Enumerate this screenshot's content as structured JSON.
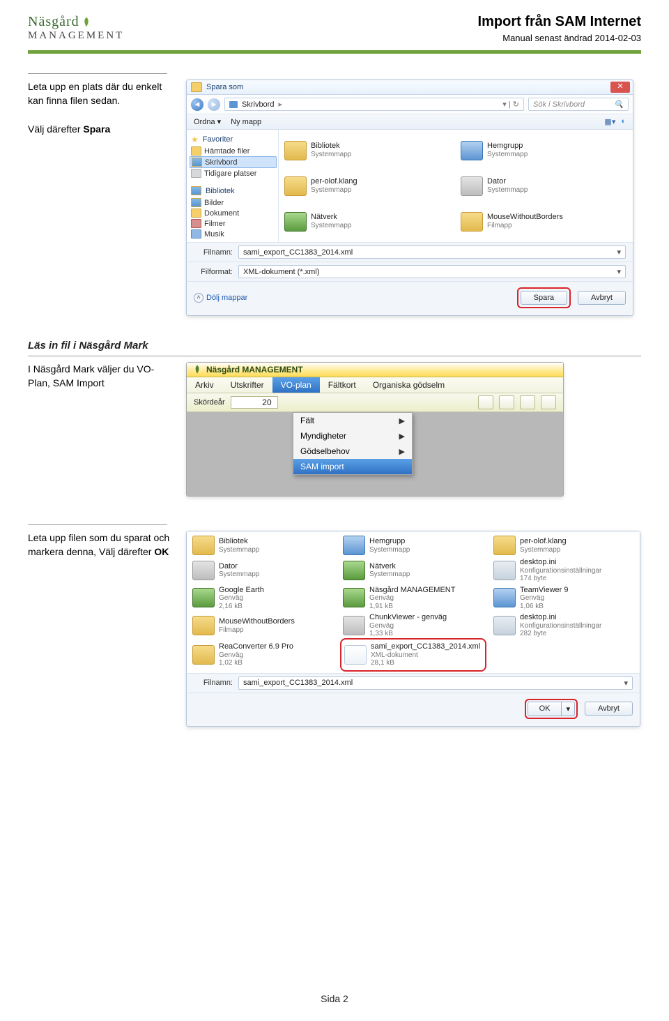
{
  "header": {
    "logo_top": "Näsgård",
    "logo_bottom": "MANAGEMENT",
    "title": "Import från SAM Internet",
    "subtitle": "Manual senast ändrad 2014-02-03"
  },
  "section1": {
    "instr_line1": "Leta upp en plats där du enkelt kan finna filen sedan.",
    "instr_line2a": "Välj därefter ",
    "instr_line2b": "Spara",
    "dlg": {
      "title": "Spara som",
      "crumb_loc": "Skrivbord",
      "search_ph": "Sök i Skrivbord",
      "tb_ordna": "Ordna ▾",
      "tb_ny": "Ny mapp",
      "tree_fav": "Favoriter",
      "tree_fav_items": [
        "Hämtade filer",
        "Skrivbord",
        "Tidigare platser"
      ],
      "tree_bib": "Bibliotek",
      "tree_bib_items": [
        "Bilder",
        "Dokument",
        "Filmer",
        "Musik"
      ],
      "grid": [
        {
          "name": "Bibliotek",
          "sub": "Systemmapp",
          "ico": "yellow"
        },
        {
          "name": "Hemgrupp",
          "sub": "Systemmapp",
          "ico": "blue"
        },
        {
          "name": "per-olof.klang",
          "sub": "Systemmapp",
          "ico": "yellow"
        },
        {
          "name": "Dator",
          "sub": "Systemmapp",
          "ico": "grey"
        },
        {
          "name": "Nätverk",
          "sub": "Systemmapp",
          "ico": "green"
        },
        {
          "name": "MouseWithoutBorders",
          "sub": "Filmapp",
          "ico": "yellow"
        }
      ],
      "filnamn_lbl": "Filnamn:",
      "filnamn_val": "sami_export_CC1383_2014.xml",
      "filformat_lbl": "Filformat:",
      "filformat_val": "XML-dokument (*.xml)",
      "dolj": "Dölj mappar",
      "btn_spara": "Spara",
      "btn_avbryt": "Avbryt"
    }
  },
  "section2": {
    "heading": "Läs in fil i Näsgård Mark",
    "instr": "I Näsgård Mark väljer du VO-Plan, SAM Import",
    "app": {
      "title": "Näsgård MANAGEMENT",
      "menu": [
        "Arkiv",
        "Utskrifter",
        "VO-plan",
        "Fältkort",
        "Organiska gödselm"
      ],
      "menu_sel": 2,
      "skordear_lbl": "Skördeår",
      "skordear_val": "20",
      "dropdown": [
        "Fält",
        "Myndigheter",
        "Gödselbehov",
        "SAM import"
      ],
      "dropdown_sel": 3
    }
  },
  "section3": {
    "instr_a": "Leta upp filen som du sparat och markera denna, Välj därefter ",
    "instr_b": "OK",
    "dlg": {
      "grid": [
        {
          "name": "Bibliotek",
          "sub": "Systemmapp",
          "ico": "yellow"
        },
        {
          "name": "Hemgrupp",
          "sub": "Systemmapp",
          "ico": "blue"
        },
        {
          "name": "per-olof.klang",
          "sub": "Systemmapp",
          "ico": "yellow"
        },
        {
          "name": "Dator",
          "sub": "Systemmapp",
          "ico": "grey"
        },
        {
          "name": "Nätverk",
          "sub": "Systemmapp",
          "ico": "green"
        },
        {
          "name": "desktop.ini",
          "sub": "Konfigurationsinställningar\n174 byte",
          "ico": "gear"
        },
        {
          "name": "Google Earth",
          "sub": "Genväg\n2,16 kB",
          "ico": "green"
        },
        {
          "name": "Näsgård MANAGEMENT",
          "sub": "Genväg\n1,91 kB",
          "ico": "green"
        },
        {
          "name": "TeamViewer 9",
          "sub": "Genväg\n1,06 kB",
          "ico": "blue"
        },
        {
          "name": "MouseWithoutBorders",
          "sub": "Filmapp",
          "ico": "yellow"
        },
        {
          "name": "ChunkViewer - genväg",
          "sub": "Genväg\n1,33 kB",
          "ico": "grey"
        },
        {
          "name": "desktop.ini",
          "sub": "Konfigurationsinställningar\n282 byte",
          "ico": "gear"
        },
        {
          "name": "ReaConverter 6.9 Pro",
          "sub": "Genväg\n1,02 kB",
          "ico": "yellow"
        },
        {
          "name": "sami_export_CC1383_2014.xml",
          "sub": "XML-dokument\n28,1 kB",
          "ico": "doc",
          "sel": true
        }
      ],
      "filnamn_lbl": "Filnamn:",
      "filnamn_val": "sami_export_CC1383_2014.xml",
      "btn_ok": "OK",
      "btn_avbryt": "Avbryt"
    }
  },
  "footer": "Sida 2"
}
